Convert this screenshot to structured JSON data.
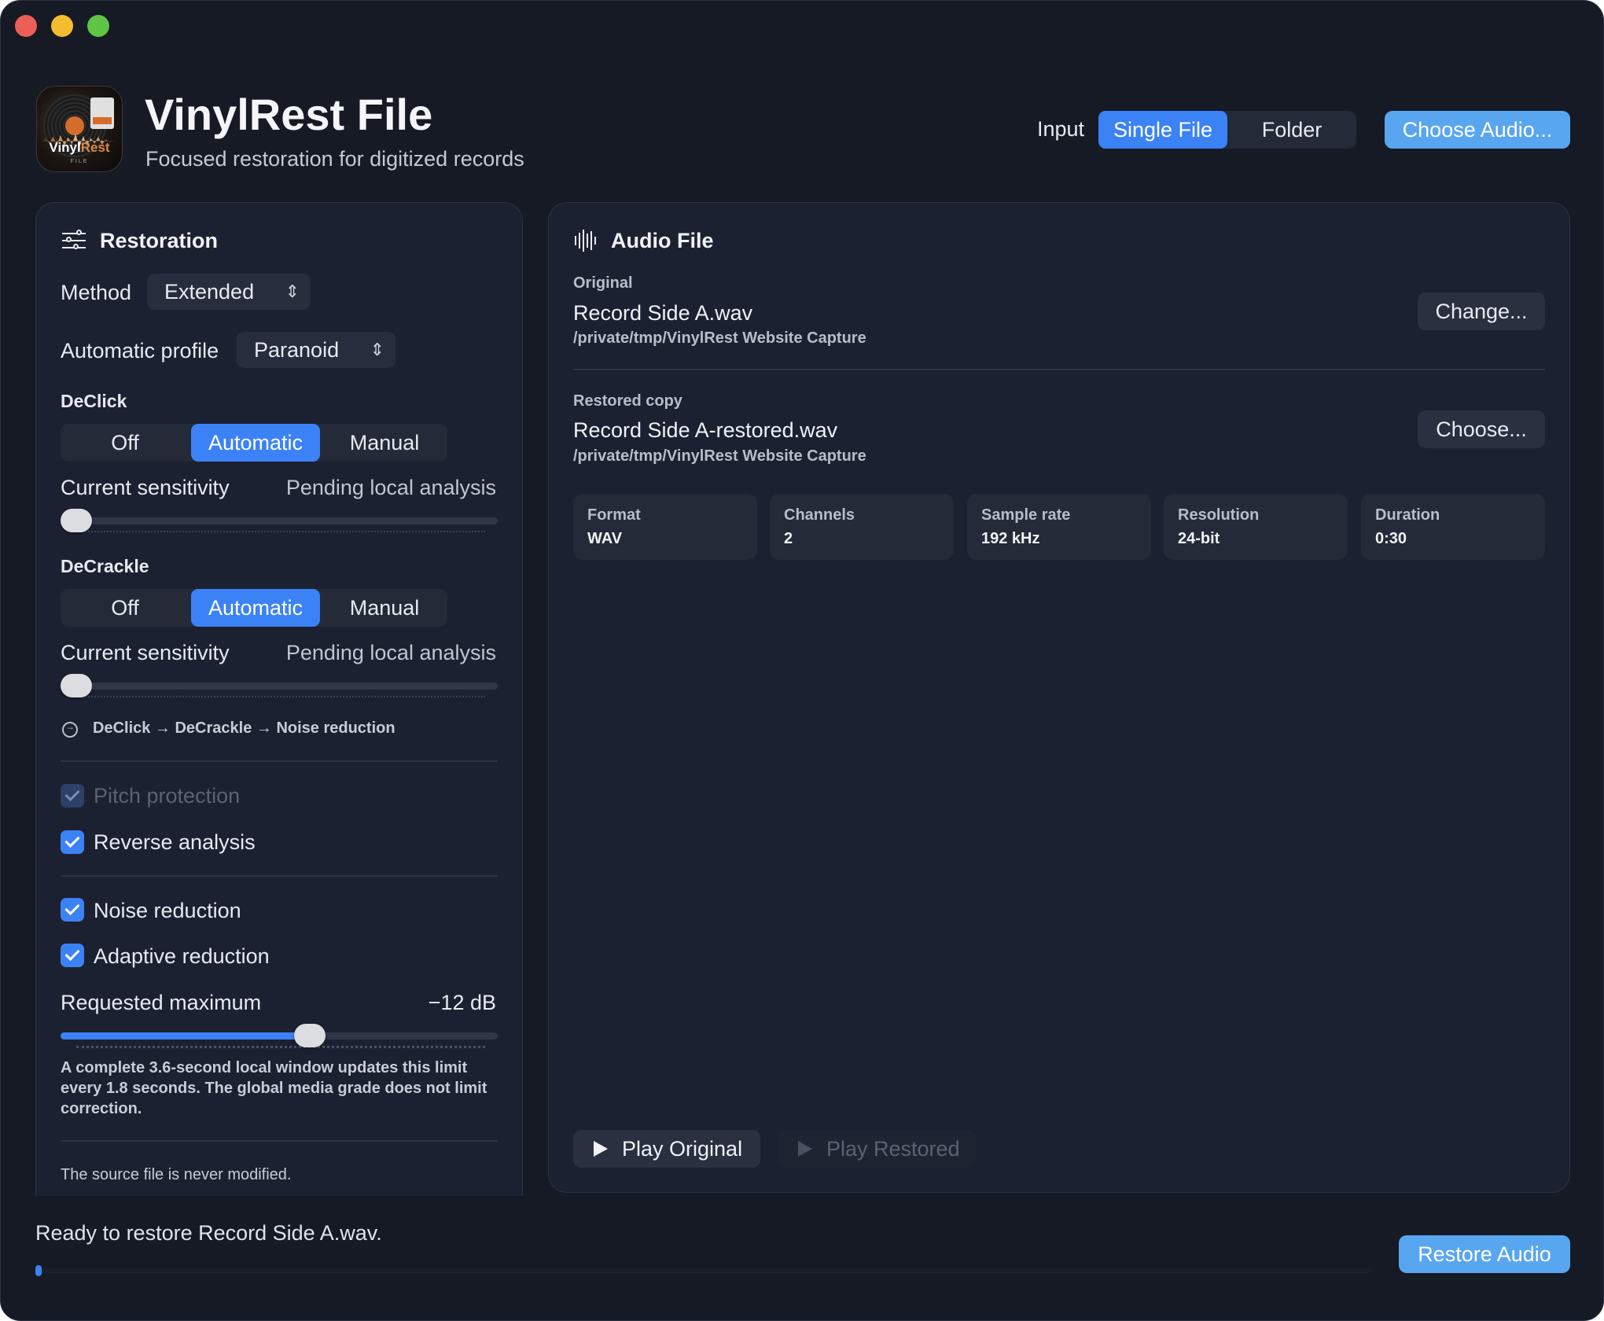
{
  "header": {
    "title": "VinylRest File",
    "subtitle": "Focused restoration for digitized records",
    "icon_brand_1": "Vinyl",
    "icon_brand_2": "Rest",
    "icon_sub": "FILE",
    "input_label": "Input",
    "input_options": [
      "Single File",
      "Folder"
    ],
    "input_selected": "Single File",
    "choose_audio": "Choose Audio..."
  },
  "restoration": {
    "title": "Restoration",
    "method_label": "Method",
    "method_value": "Extended",
    "profile_label": "Automatic profile",
    "profile_value": "Paranoid",
    "declick": {
      "title": "DeClick",
      "options": [
        "Off",
        "Automatic",
        "Manual"
      ],
      "selected": "Automatic",
      "sensitivity_label": "Current sensitivity",
      "sensitivity_value": "Pending local analysis",
      "slider_value": 0
    },
    "decrackle": {
      "title": "DeCrackle",
      "options": [
        "Off",
        "Automatic",
        "Manual"
      ],
      "selected": "Automatic",
      "sensitivity_label": "Current sensitivity",
      "sensitivity_value": "Pending local analysis",
      "slider_value": 0
    },
    "chain": "DeClick → DeCrackle → Noise reduction",
    "pitch_protection": {
      "label": "Pitch protection",
      "checked": true,
      "enabled": false
    },
    "reverse_analysis": {
      "label": "Reverse analysis",
      "checked": true,
      "enabled": true
    },
    "noise_reduction": {
      "label": "Noise reduction",
      "checked": true,
      "enabled": true
    },
    "adaptive_reduction": {
      "label": "Adaptive reduction",
      "checked": true,
      "enabled": true
    },
    "requested_max_label": "Requested maximum",
    "requested_max_value": "−12 dB",
    "requested_max_fraction": 0.57,
    "note": "A complete 3.6-second local window updates this limit every 1.8 seconds. The global media grade does not limit correction.",
    "footnote": "The source file is never modified."
  },
  "audio_file": {
    "title": "Audio File",
    "original_caption": "Original",
    "original_name": "Record Side A.wav",
    "original_path": "/private/tmp/VinylRest Website Capture",
    "change_button": "Change...",
    "restored_caption": "Restored copy",
    "restored_name": "Record Side A-restored.wav",
    "restored_path": "/private/tmp/VinylRest Website Capture",
    "choose_button": "Choose...",
    "stats": [
      {
        "label": "Format",
        "value": "WAV"
      },
      {
        "label": "Channels",
        "value": "2"
      },
      {
        "label": "Sample rate",
        "value": "192 kHz"
      },
      {
        "label": "Resolution",
        "value": "24-bit"
      },
      {
        "label": "Duration",
        "value": "0:30"
      }
    ],
    "play_original": "Play Original",
    "play_restored": "Play Restored"
  },
  "footer": {
    "status": "Ready to restore Record Side A.wav.",
    "restore_button": "Restore Audio"
  },
  "colors": {
    "accent": "#3b82f6",
    "button_blue": "#59a6f0",
    "window_bg": "#161a25",
    "panel_bg": "#1c2131"
  }
}
